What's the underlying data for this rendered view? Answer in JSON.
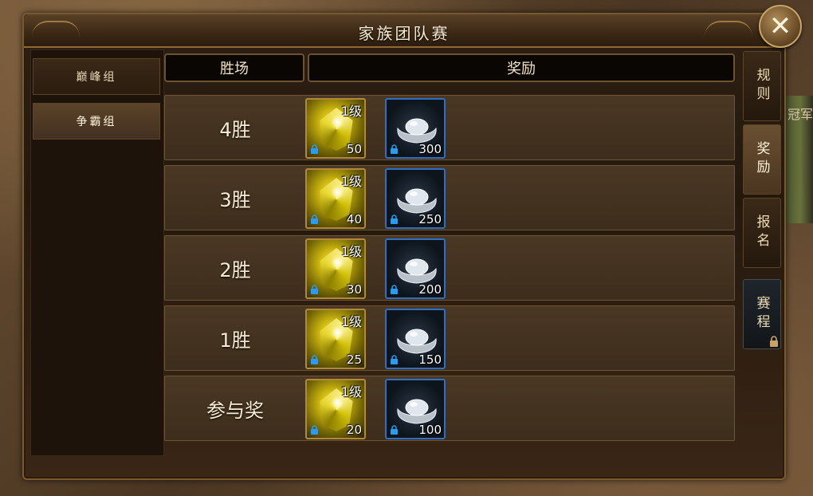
{
  "window": {
    "title": "家族团队赛"
  },
  "groups": [
    {
      "label": "巅峰组"
    },
    {
      "label": "争霸组"
    }
  ],
  "table": {
    "headers": {
      "wins": "胜场",
      "reward": "奖励"
    },
    "rows": [
      {
        "label": "4胜",
        "gem_level": "1级",
        "gem_count": "50",
        "silver_count": "300"
      },
      {
        "label": "3胜",
        "gem_level": "1级",
        "gem_count": "40",
        "silver_count": "250"
      },
      {
        "label": "2胜",
        "gem_level": "1级",
        "gem_count": "30",
        "silver_count": "200"
      },
      {
        "label": "1胜",
        "gem_level": "1级",
        "gem_count": "25",
        "silver_count": "150"
      },
      {
        "label": "参与奖",
        "gem_level": "1级",
        "gem_count": "20",
        "silver_count": "100"
      }
    ]
  },
  "side_tabs": [
    {
      "label": "规则"
    },
    {
      "label": "奖励"
    },
    {
      "label": "报名"
    },
    {
      "label": "赛程"
    }
  ],
  "background_text": "冠军",
  "colors": {
    "gold_border": "#b08a3a",
    "blue_border": "#2f6fc0",
    "panel_bg": "#24180d"
  }
}
